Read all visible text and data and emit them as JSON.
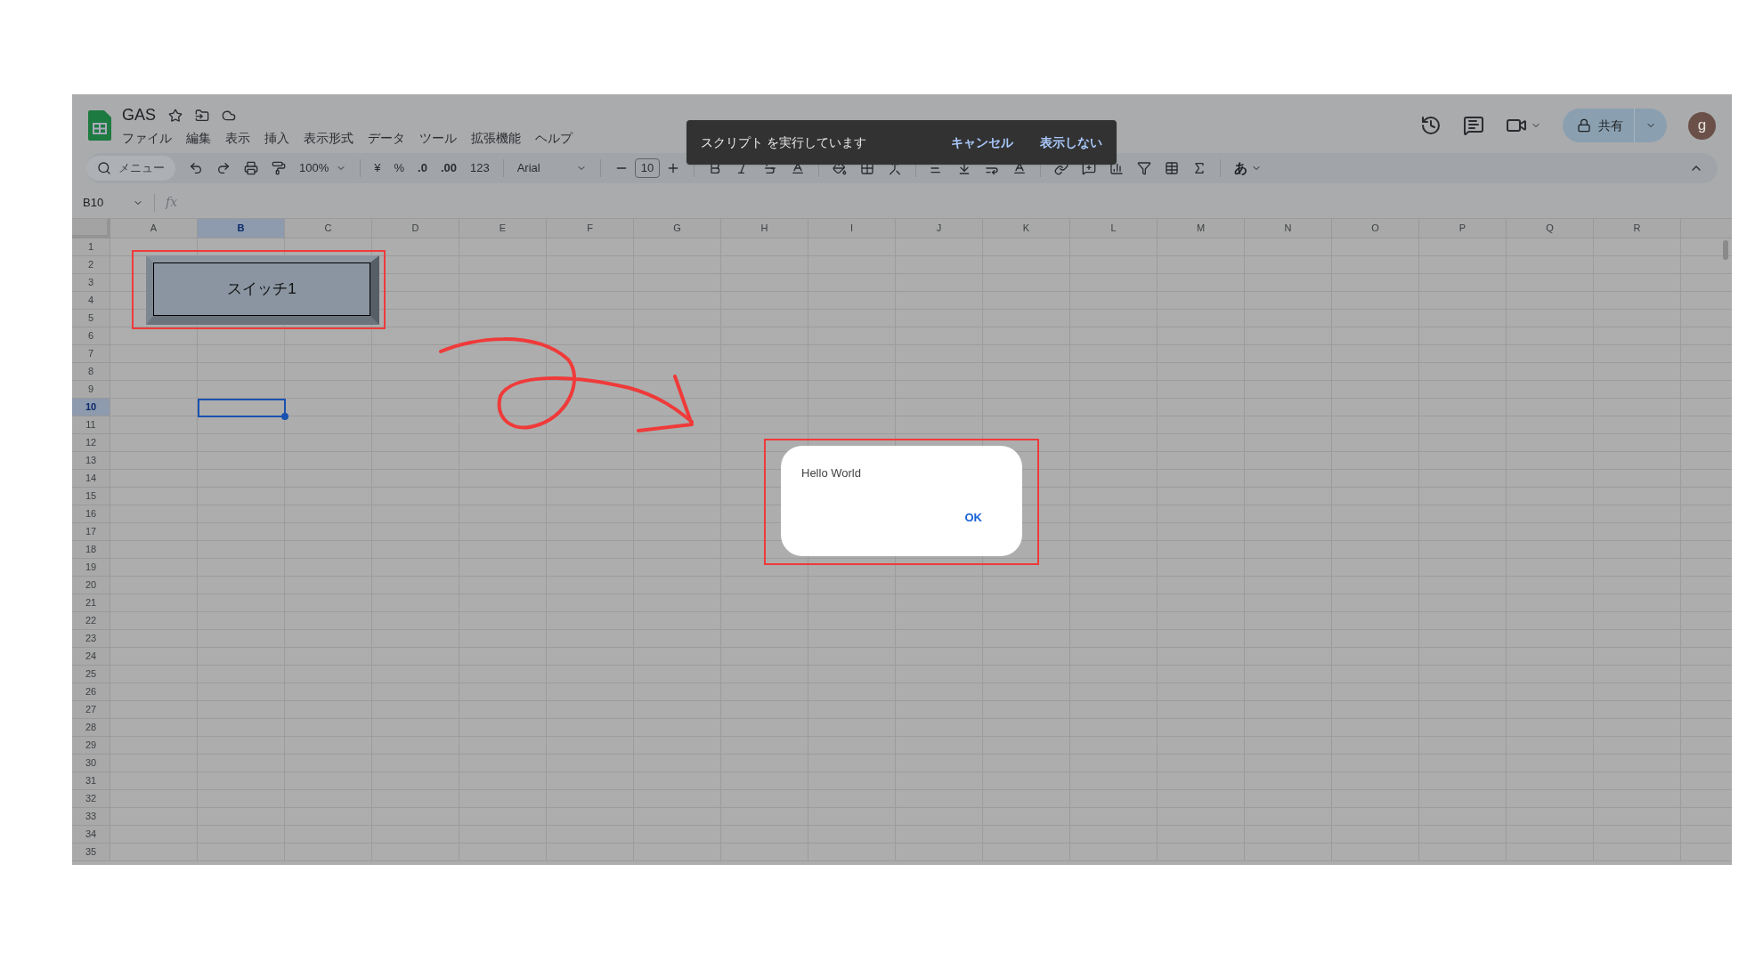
{
  "document": {
    "title": "GAS"
  },
  "menu": [
    "ファイル",
    "編集",
    "表示",
    "挿入",
    "表示形式",
    "データ",
    "ツール",
    "拡張機能",
    "ヘルプ"
  ],
  "share_button": {
    "label": "共有"
  },
  "avatar": {
    "initial": "g"
  },
  "toolbar": {
    "search_placeholder": "メニュー",
    "zoom": "100%",
    "currency": "¥",
    "percent": "%",
    "decrease_decimal": ".0",
    "increase_decimal": ".00",
    "number_format": "123",
    "font": "Arial",
    "font_size": "10",
    "input_method": "あ"
  },
  "formula_bar": {
    "name_box": "B10",
    "formula_label": "fx"
  },
  "grid": {
    "columns": [
      {
        "label": "A",
        "selected": false
      },
      {
        "label": "B",
        "selected": true
      },
      {
        "label": "C",
        "selected": false
      },
      {
        "label": "D",
        "selected": false
      },
      {
        "label": "E",
        "selected": false
      },
      {
        "label": "F",
        "selected": false
      },
      {
        "label": "G",
        "selected": false
      },
      {
        "label": "H",
        "selected": false
      },
      {
        "label": "I",
        "selected": false
      },
      {
        "label": "J",
        "selected": false
      },
      {
        "label": "K",
        "selected": false
      },
      {
        "label": "L",
        "selected": false
      },
      {
        "label": "M",
        "selected": false
      },
      {
        "label": "N",
        "selected": false
      },
      {
        "label": "O",
        "selected": false
      },
      {
        "label": "P",
        "selected": false
      },
      {
        "label": "Q",
        "selected": false
      },
      {
        "label": "R",
        "selected": false
      }
    ],
    "rows": [
      {
        "label": "1",
        "selected": false
      },
      {
        "label": "2",
        "selected": false
      },
      {
        "label": "3",
        "selected": false
      },
      {
        "label": "4",
        "selected": false
      },
      {
        "label": "5",
        "selected": false
      },
      {
        "label": "6",
        "selected": false
      },
      {
        "label": "7",
        "selected": false
      },
      {
        "label": "8",
        "selected": false
      },
      {
        "label": "9",
        "selected": false
      },
      {
        "label": "10",
        "selected": true
      },
      {
        "label": "11",
        "selected": false
      },
      {
        "label": "12",
        "selected": false
      },
      {
        "label": "13",
        "selected": false
      },
      {
        "label": "14",
        "selected": false
      },
      {
        "label": "15",
        "selected": false
      },
      {
        "label": "16",
        "selected": false
      },
      {
        "label": "17",
        "selected": false
      },
      {
        "label": "18",
        "selected": false
      },
      {
        "label": "19",
        "selected": false
      },
      {
        "label": "20",
        "selected": false
      },
      {
        "label": "21",
        "selected": false
      },
      {
        "label": "22",
        "selected": false
      },
      {
        "label": "23",
        "selected": false
      },
      {
        "label": "24",
        "selected": false
      },
      {
        "label": "25",
        "selected": false
      },
      {
        "label": "26",
        "selected": false
      },
      {
        "label": "27",
        "selected": false
      },
      {
        "label": "28",
        "selected": false
      },
      {
        "label": "29",
        "selected": false
      },
      {
        "label": "30",
        "selected": false
      },
      {
        "label": "31",
        "selected": false
      },
      {
        "label": "32",
        "selected": false
      },
      {
        "label": "33",
        "selected": false
      },
      {
        "label": "34",
        "selected": false
      },
      {
        "label": "35",
        "selected": false
      }
    ]
  },
  "drawing_button": {
    "label": "スイッチ1"
  },
  "toast": {
    "message": "スクリプト を実行しています",
    "actions": [
      "キャンセル",
      "表示しない"
    ]
  },
  "dialog": {
    "message": "Hello World",
    "button": "OK"
  }
}
